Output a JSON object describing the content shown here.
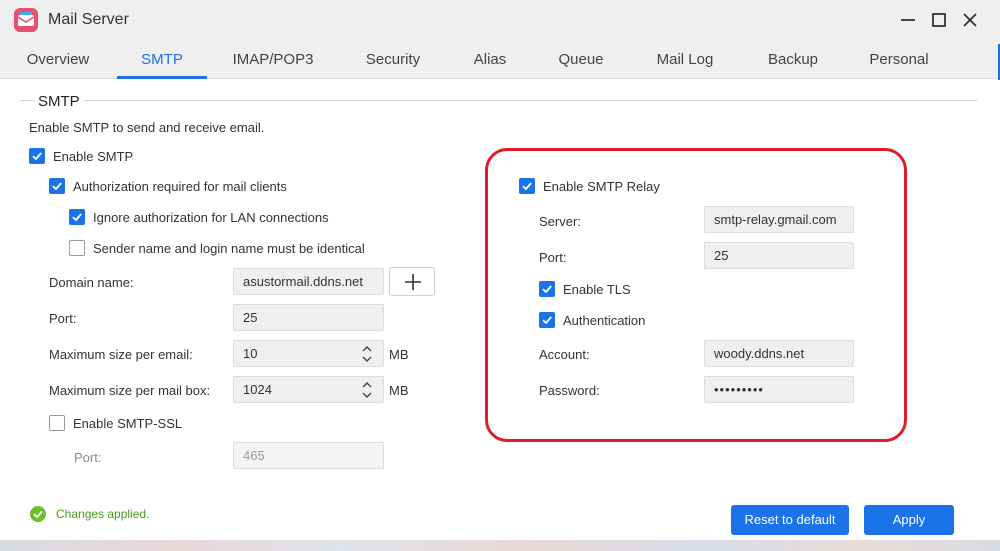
{
  "window": {
    "title": "Mail Server",
    "icon": "mail-server-icon"
  },
  "tabs": [
    {
      "label": "Overview"
    },
    {
      "label": "SMTP",
      "active": true
    },
    {
      "label": "IMAP/POP3"
    },
    {
      "label": "Security"
    },
    {
      "label": "Alias"
    },
    {
      "label": "Queue"
    },
    {
      "label": "Mail Log"
    },
    {
      "label": "Backup"
    },
    {
      "label": "Personal"
    }
  ],
  "smtp": {
    "section_title": "SMTP",
    "description": "Enable SMTP to send and receive email.",
    "enable_smtp": {
      "label": "Enable SMTP",
      "checked": true
    },
    "auth_required": {
      "label": "Authorization required for mail clients",
      "checked": true
    },
    "ignore_lan": {
      "label": "Ignore authorization for LAN connections",
      "checked": true
    },
    "sender_identical": {
      "label": "Sender name and login name must be identical",
      "checked": false
    },
    "domain": {
      "label": "Domain name:",
      "value": "asustormail.ddns.net"
    },
    "port": {
      "label": "Port:",
      "value": "25"
    },
    "max_email": {
      "label": "Maximum size per email:",
      "value": "10",
      "unit": "MB"
    },
    "max_mailbox": {
      "label": "Maximum size per mail box:",
      "value": "1024",
      "unit": "MB"
    },
    "smtp_ssl": {
      "label": "Enable SMTP-SSL",
      "checked": false
    },
    "ssl_port": {
      "label": "Port:",
      "value": "465"
    }
  },
  "relay": {
    "enable": {
      "label": "Enable SMTP Relay",
      "checked": true
    },
    "server": {
      "label": "Server:",
      "value": "smtp-relay.gmail.com"
    },
    "port": {
      "label": "Port:",
      "value": "25"
    },
    "tls": {
      "label": "Enable TLS",
      "checked": true
    },
    "auth": {
      "label": "Authentication",
      "checked": true
    },
    "account": {
      "label": "Account:",
      "value": "woody.ddns.net"
    },
    "password": {
      "label": "Password:",
      "value": "•••••••••"
    }
  },
  "status": {
    "text": "Changes applied.",
    "icon": "check-circle-icon"
  },
  "buttons": {
    "reset": "Reset to default",
    "apply": "Apply"
  },
  "colors": {
    "accent": "#1a73e8",
    "success": "#4a9b1a",
    "highlight": "#e01b2a"
  }
}
